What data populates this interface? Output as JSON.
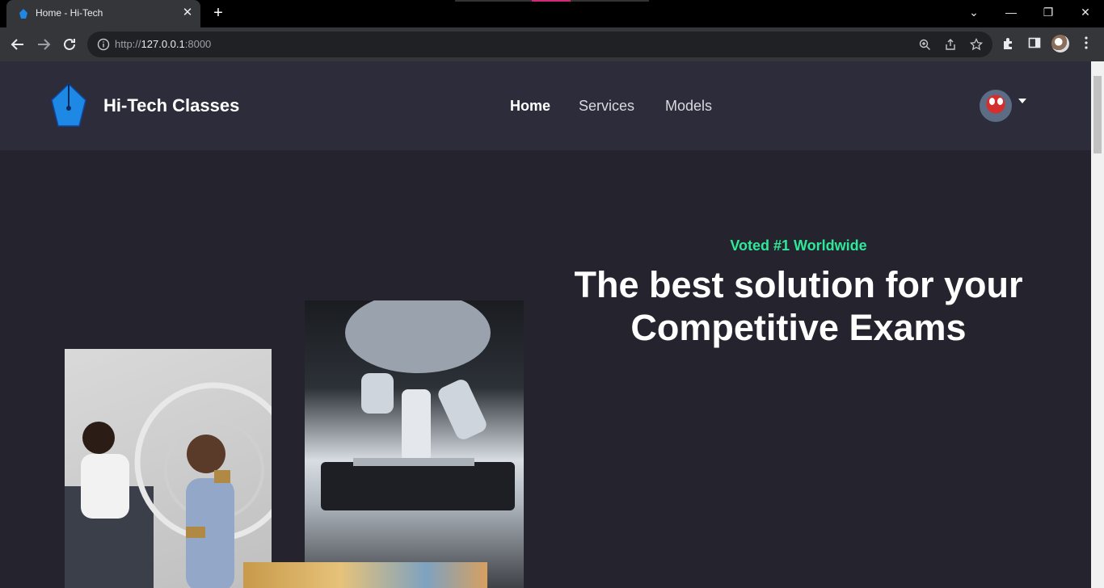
{
  "browser": {
    "tab_title": "Home - Hi-Tech",
    "tab_close_glyph": "✕",
    "new_tab_glyph": "+",
    "url_scheme": "http://",
    "url_host": "127.0.0.1",
    "url_port": ":8000",
    "window_controls": [
      "⌄",
      "—",
      "❐",
      "✕"
    ],
    "icons": [
      "back-arrow-icon",
      "forward-arrow-icon",
      "reload-icon",
      "info-icon",
      "zoom-icon",
      "share-icon",
      "star-icon",
      "extensions-icon",
      "side-panel-icon",
      "profile-avatar-icon",
      "menu-kebab-icon"
    ]
  },
  "site": {
    "brand": "Hi-Tech Classes",
    "nav": [
      {
        "label": "Home",
        "active": true
      },
      {
        "label": "Services",
        "active": false
      },
      {
        "label": "Models",
        "active": false
      }
    ]
  },
  "hero": {
    "eyebrow": "Voted #1 Worldwide",
    "title_line1": "The best solution for your",
    "title_line2": "Competitive Exams"
  },
  "colors": {
    "page_bg": "#25242e",
    "header_bg": "#2d2c3b",
    "accent_green": "#2ee89a",
    "logo_blue": "#1e88e5"
  }
}
